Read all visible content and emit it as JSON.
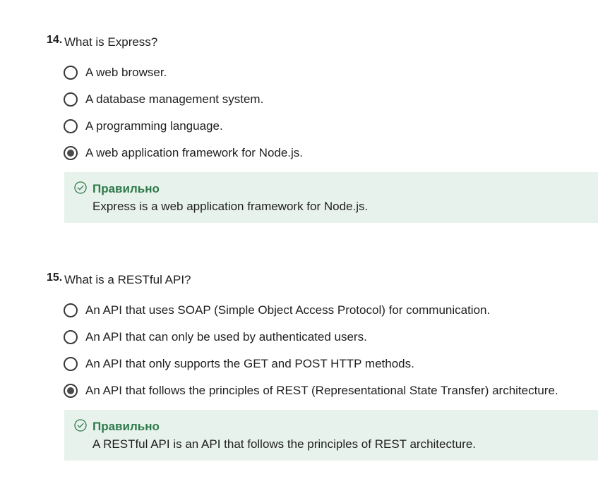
{
  "questions": [
    {
      "number": "14.",
      "text": "What is Express?",
      "options": [
        {
          "label": "A web browser.",
          "selected": false
        },
        {
          "label": "A database management system.",
          "selected": false
        },
        {
          "label": "A programming language.",
          "selected": false
        },
        {
          "label": "A web application framework for Node.js.",
          "selected": true
        }
      ],
      "feedback": {
        "title": "Правильно",
        "text": "Express is a web application framework for Node.js."
      }
    },
    {
      "number": "15.",
      "text": "What is a RESTful API?",
      "options": [
        {
          "label": "An API that uses SOAP (Simple Object Access Protocol) for communication.",
          "selected": false
        },
        {
          "label": "An API that can only be used by authenticated users.",
          "selected": false
        },
        {
          "label": "An API that only supports the GET and POST HTTP methods.",
          "selected": false
        },
        {
          "label": "An API that follows the principles of REST (Representational State Transfer) architecture.",
          "selected": true
        }
      ],
      "feedback": {
        "title": "Правильно",
        "text": "A RESTful API is an API that follows the principles of REST architecture."
      }
    }
  ],
  "colors": {
    "feedback_bg": "#e8f2ec",
    "correct_accent": "#2e7a4a",
    "radio_border": "#3a3a3a"
  },
  "icons": {
    "feedback": "check-circle-icon"
  }
}
